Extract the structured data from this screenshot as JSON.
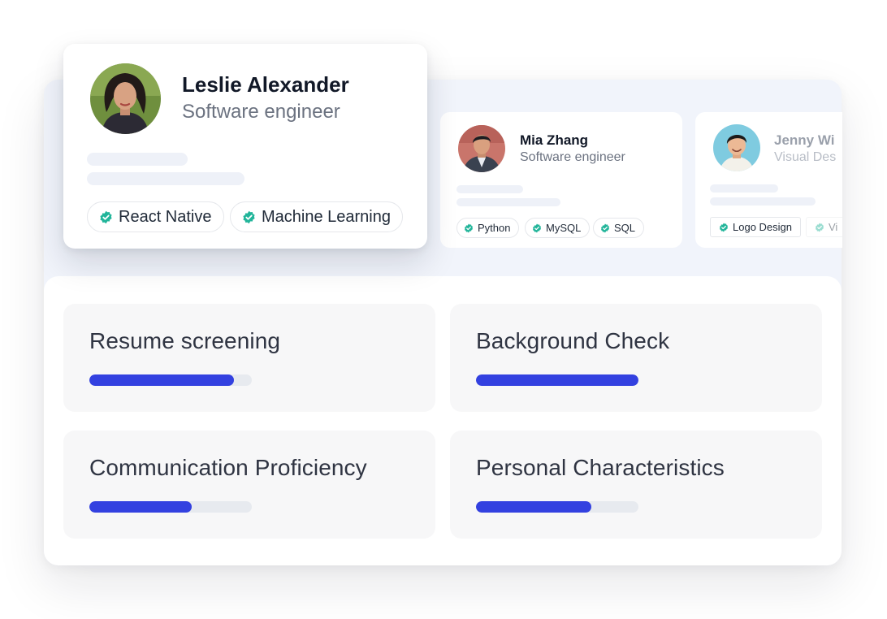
{
  "featured": {
    "name": "Leslie Alexander",
    "role": "Software engineer",
    "skills": [
      "React Native",
      "Machine Learning"
    ]
  },
  "candidates": [
    {
      "name": "Mia Zhang",
      "role": "Software engineer",
      "skills": [
        "Python",
        "MySQL",
        "SQL"
      ]
    },
    {
      "name": "Jenny Wi",
      "role": "Visual Des",
      "skills": [
        "Logo Design",
        "Vi"
      ]
    }
  ],
  "metrics": [
    {
      "label": "Resume screening",
      "progress": 0.89
    },
    {
      "label": "Background Check",
      "progress": 1.0
    },
    {
      "label": "Communication Proficiency",
      "progress": 0.63
    },
    {
      "label": "Personal Characteristics",
      "progress": 0.71
    }
  ],
  "colors": {
    "accent": "#3341e0",
    "verified": "#22b59a",
    "track": "#e7eaef"
  },
  "icons": {
    "verified": "verified-badge-icon"
  }
}
